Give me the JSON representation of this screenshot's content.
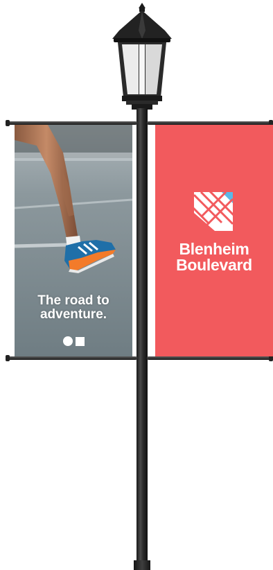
{
  "left_banner": {
    "tagline_line1": "The road to",
    "tagline_line2": "adventure."
  },
  "right_banner": {
    "name_line1": "Blenheim",
    "name_line2": "Boulevard",
    "background_color": "#f25a5d",
    "logo_accent_color": "#5ab8e8"
  },
  "icons": [
    "street-lamp-icon",
    "blenheim-logo-icon",
    "circle-mark-icon",
    "square-mark-icon"
  ]
}
